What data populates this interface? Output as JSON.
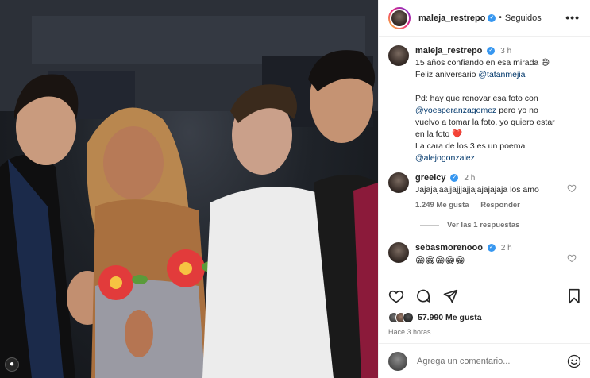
{
  "post": {
    "author": "maleja_restrepo",
    "follow_status": "Seguidos",
    "more_icon": "more-horizontal-icon"
  },
  "caption": {
    "author": "maleja_restrepo",
    "time": "3 h",
    "line1": "15 años confiando en esa mirada 😄",
    "line2_text": "Feliz aniversario ",
    "line2_mention": "@tatanmejia",
    "line3": "Pd: hay que renovar esa foto con",
    "line4_mention": "@yoesperanzagomez",
    "line4_text": " pero yo no",
    "line5": "vuelvo a tomar la foto, yo quiero estar",
    "line6_text": "en la foto ",
    "line6_emoji": "❤️",
    "line7": "La cara de los 3 es un poema",
    "line8_mention": "@alejogonzalez"
  },
  "comments": [
    {
      "author": "greeicy",
      "time": "2 h",
      "text": "Jajajajaajjajjjajjajajajajaja los amo",
      "likes": "1.249 Me gusta",
      "reply": "Responder"
    },
    {
      "author": "sebasmorenooo",
      "time": "2 h",
      "text": "😁😁😁😁😁"
    }
  ],
  "view_replies": "Ver las 1 respuestas",
  "actions": {
    "like_icon": "heart-icon",
    "comment_icon": "comment-icon",
    "share_icon": "send-icon",
    "save_icon": "bookmark-icon"
  },
  "likes": "57.990 Me gusta",
  "posted": "Hace 3 horas",
  "add_comment": {
    "placeholder": "Agrega un comentario...",
    "emoji_icon": "emoji-icon"
  },
  "colors": {
    "accent": "#3797f0",
    "mention": "#00376b",
    "muted": "#737373"
  }
}
